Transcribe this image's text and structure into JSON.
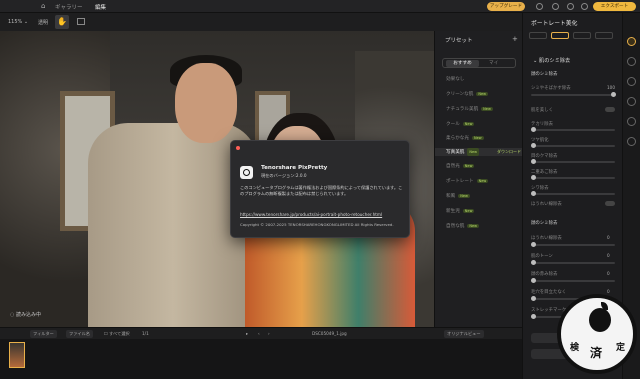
{
  "topbar": {
    "tabs": [
      "ギャラリー",
      "編集"
    ],
    "upgrade_label": "アップグレード",
    "export_label": "エクスポート"
  },
  "toolbar": {
    "zoom": "115%",
    "zoom_chevron": "⌄",
    "mode_label": "透明"
  },
  "canvas": {
    "loading_text": "読み込み中"
  },
  "presets": {
    "title": "プリセット",
    "add": "+",
    "segments": [
      "おすすめ",
      "マイ"
    ],
    "items": [
      {
        "label": "効果なし",
        "new": false
      },
      {
        "label": "クリーンな肌",
        "new": true
      },
      {
        "label": "ナチュラル美肌",
        "new": true
      },
      {
        "label": "クール",
        "new": true
      },
      {
        "label": "柔らかな光",
        "new": true
      },
      {
        "label": "写真美肌",
        "new": true,
        "selected": true,
        "download": "ダウンロード"
      },
      {
        "label": "自然光",
        "new": true
      },
      {
        "label": "ポートレート",
        "new": true
      },
      {
        "label": "和風",
        "new": true
      },
      {
        "label": "新生児",
        "new": true
      },
      {
        "label": "自然な肌",
        "new": true
      }
    ],
    "new_tag": "New"
  },
  "right_panel": {
    "title": "ポートレート美化",
    "section": "肌のシミ除去",
    "rows": [
      {
        "label": "顔のシミ除去",
        "type": "header"
      },
      {
        "label": "シミやそばかす除去",
        "type": "slider",
        "value": "100"
      },
      {
        "label": "肌を美しく",
        "type": "toggle"
      },
      {
        "label": "テカリ除去",
        "type": "slider"
      },
      {
        "label": "ツヤ肌化",
        "type": "slider"
      },
      {
        "label": "目のクマ除去",
        "type": "slider"
      },
      {
        "label": "二重あご除去",
        "type": "slider"
      },
      {
        "label": "シワ除去",
        "type": "slider"
      },
      {
        "label": "ほうれい線除去",
        "type": "toggle"
      },
      {
        "label": "顔のシミ除去",
        "type": "header"
      },
      {
        "label": "ほうれい線除去",
        "type": "slider",
        "value": "0"
      },
      {
        "label": "肌のトーン",
        "type": "slider",
        "value": "0"
      },
      {
        "label": "顔の赤み除去",
        "type": "slider",
        "value": "0"
      },
      {
        "label": "毛穴を目立たなく",
        "type": "slider",
        "value": "0"
      },
      {
        "label": "ストレッチマーク",
        "type": "slider",
        "value": "0"
      }
    ]
  },
  "bottombar": {
    "chips": [
      "フィルター",
      "ファイル名"
    ],
    "select_all": "すべて選択",
    "count": "1/1",
    "filename": "DSC05049_1.jpg",
    "compare_label": "オリジナルビュー"
  },
  "dialog": {
    "app_name": "Tenorshare PixPretty",
    "version": "現在のバージョン:2.0.0",
    "description": "このコンピュータプログラムは著作権法および国際条約によって保護されています。このプログラムの無断複製または配布は禁じられています。",
    "url": "https://www.tenorshare.jp/products/ai-portrait-photo-retoucher.html",
    "copyright": "Copyright © 2007-2025 TENORSHAREHONGKONGLIMITED All Rights Reserved."
  },
  "badge": {
    "chars": [
      "検",
      "済",
      "定"
    ]
  }
}
